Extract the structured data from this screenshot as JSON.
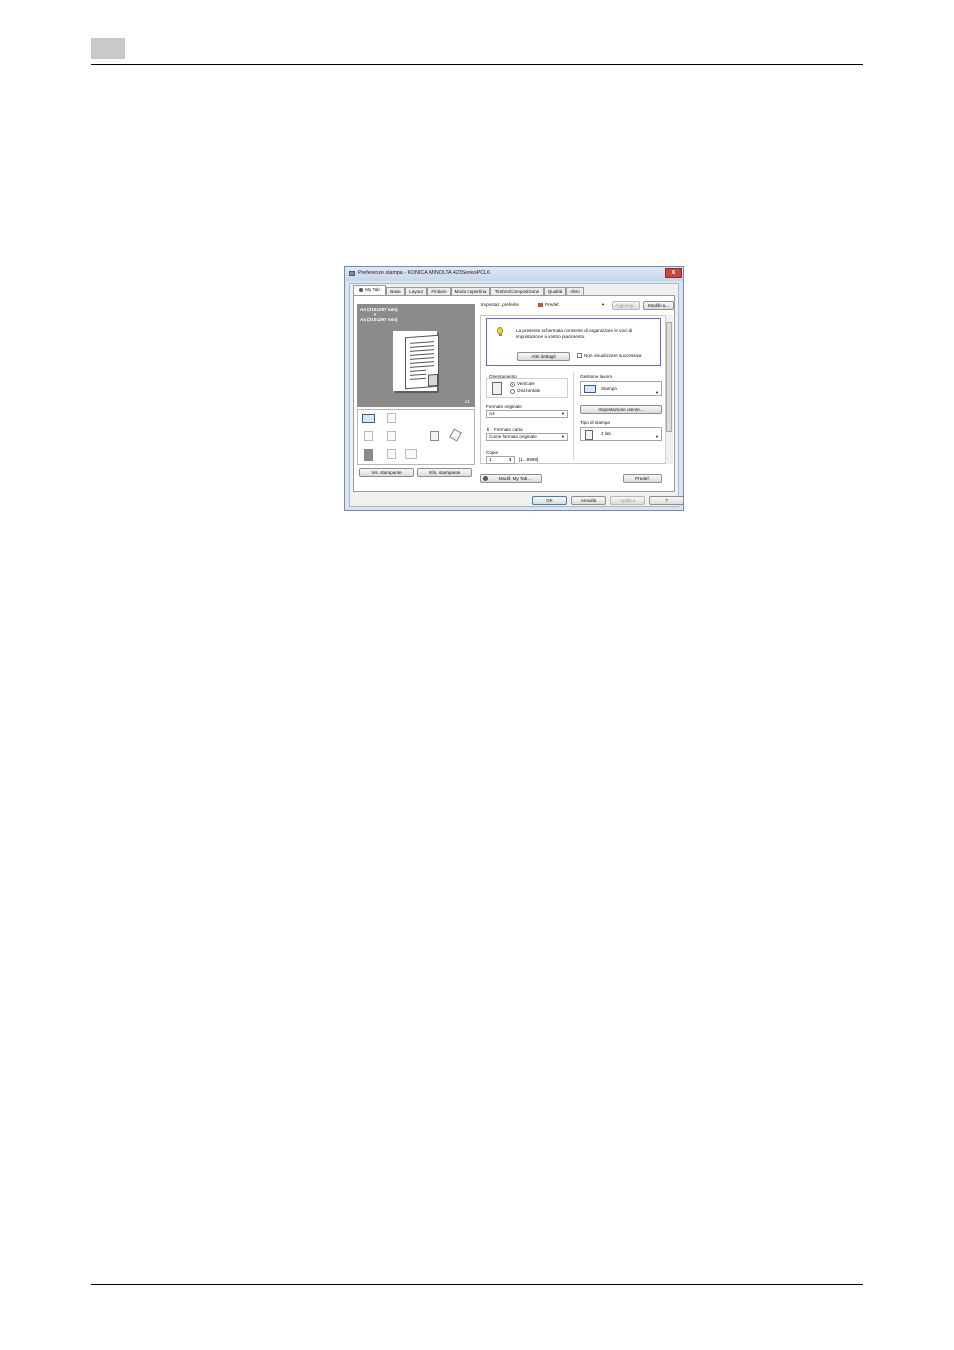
{
  "dialog": {
    "title": "Preferenze stampa - KONICA MINOLTA 423SeriesPCL6",
    "close_label": "x",
    "tabs": [
      "My Tab",
      "Base",
      "Layout",
      "Finiture",
      "Modo copertina",
      "Timbro/Composizione",
      "Qualità",
      "Altro"
    ],
    "preview": {
      "original_size": "A4 (210x297 mm)",
      "arrow": "▼",
      "paper_size": "A4 (210x297 mm)",
      "copies_marker": "x1"
    },
    "left_buttons": {
      "view_printer": "Vis. stampante",
      "device_info": "Info. stampante"
    },
    "favorites": {
      "label": "Impostaz. preferite",
      "value": "Predef.",
      "add": "Aggiungi...",
      "edit": "Modifica..."
    },
    "info": {
      "text_line1": "La presente schermata consente di organizzare le voci di",
      "text_line2": "impostazione a vostro piacimento.",
      "details_button": "Altri dettagli",
      "hide_checkbox": "Non visualizzare successiva"
    },
    "orientation": {
      "label": "Orientamento",
      "portrait": "Verticale",
      "landscape": "Orizzontale",
      "selected": "portrait"
    },
    "original_size": {
      "label": "Formato originale",
      "value": "A4"
    },
    "paper_size": {
      "label": "Formato carta",
      "value": "Come formato originale"
    },
    "copies": {
      "label": "Copie",
      "value": "1",
      "range": "[1...9999]"
    },
    "job_management": {
      "label": "Gestione lavoro",
      "value": "Stampa",
      "user_settings_button": "Impostazione utente..."
    },
    "print_type": {
      "label": "Tipo di stampa",
      "value": "2 lati"
    },
    "bottom": {
      "edit_my_tab": "Modif. My Tab...",
      "default": "Predef."
    },
    "footer_buttons": [
      "OK",
      "Annulla",
      "Applica",
      "?"
    ]
  }
}
